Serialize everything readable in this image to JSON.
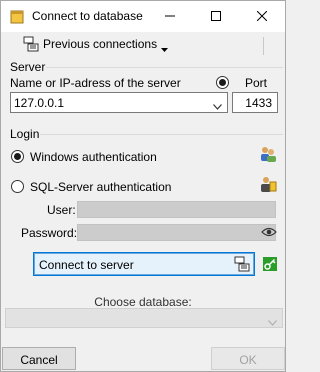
{
  "window": {
    "title": "Connect to database"
  },
  "toolbar": {
    "previous_connections": "Previous connections"
  },
  "server": {
    "legend": "Server",
    "name_label": "Name or IP-adress of the server",
    "name_value": "127.0.0.1",
    "port_label": "Port",
    "port_value": "1433"
  },
  "login": {
    "legend": "Login",
    "windows_auth": "Windows authentication",
    "sql_auth": "SQL-Server authentication",
    "user_label": "User:",
    "password_label": "Password:",
    "selected": "windows"
  },
  "actions": {
    "connect": "Connect to server",
    "choose_db_label": "Choose database:",
    "cancel": "Cancel",
    "ok": "OK"
  },
  "colors": {
    "accent": "#0078d7",
    "key_icon": "#2a9d2a"
  }
}
